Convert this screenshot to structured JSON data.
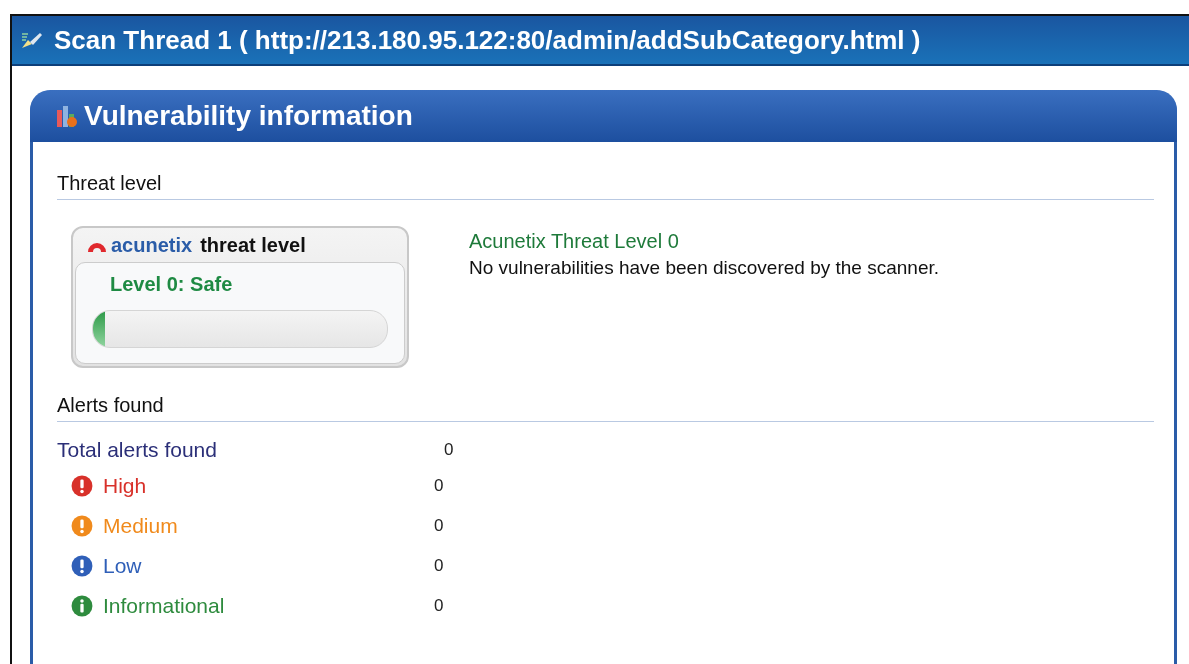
{
  "window": {
    "title": "Scan Thread 1 ( http://213.180.95.122:80/admin/addSubCategory.html )"
  },
  "panel": {
    "title": "Vulnerability information"
  },
  "threat_section": {
    "heading": "Threat level",
    "gauge": {
      "brand": "acunetix",
      "title": "threat level",
      "status": "Level 0: Safe",
      "level": 0.04
    },
    "description": {
      "title": "Acunetix Threat Level 0",
      "text": "No vulnerabilities have been discovered by the scanner."
    }
  },
  "alerts_section": {
    "heading": "Alerts found",
    "total": {
      "label": "Total alerts found",
      "count": "0"
    },
    "alerts": [
      {
        "label": "High",
        "count": "0",
        "color": "#d8312a",
        "kind": "warning"
      },
      {
        "label": "Medium",
        "count": "0",
        "color": "#f08a1c",
        "kind": "warning"
      },
      {
        "label": "Low",
        "count": "0",
        "color": "#2f5fb8",
        "kind": "warning"
      },
      {
        "label": "Informational",
        "count": "0",
        "color": "#2e8b3e",
        "kind": "info"
      }
    ]
  }
}
